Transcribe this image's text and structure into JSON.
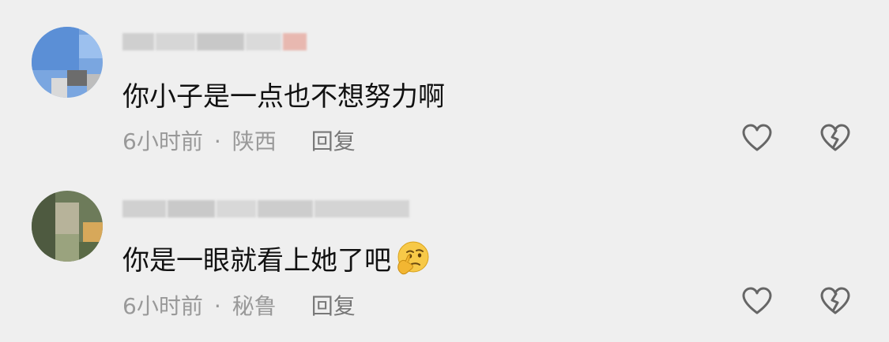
{
  "comments": [
    {
      "text": "你小子是一点也不想努力啊",
      "time": "6小时前",
      "separator": "·",
      "location": "陕西",
      "reply_label": "回复",
      "avatar_colors": [
        "#7aa6e0",
        "#5b8fd6",
        "#9cc0ee",
        "#d9d9d9",
        "#6c6c6c"
      ],
      "username_colors": [
        "#cfcfcf",
        "#d6d6d6",
        "#c8c8c8",
        "#dadada",
        "#e8b8b0"
      ]
    },
    {
      "text": "你是一眼就看上她了吧",
      "emoji_icon": "thinking-face-icon",
      "time": "6小时前",
      "separator": "·",
      "location": "秘鲁",
      "reply_label": "回复",
      "avatar_colors": [
        "#6d7b5a",
        "#9aa37e",
        "#4e5a40",
        "#b7b39a",
        "#d7a85a"
      ],
      "username_colors": [
        "#d0d0d0",
        "#c9c9c9",
        "#d8d8d8",
        "#cdcdcd",
        "#d4d4d4"
      ]
    }
  ],
  "icons": {
    "like": "heart-outline-icon",
    "dislike": "broken-heart-icon"
  },
  "colors": {
    "background": "#efefef",
    "text": "#111111",
    "meta": "#999999",
    "icon_stroke": "#666666"
  }
}
